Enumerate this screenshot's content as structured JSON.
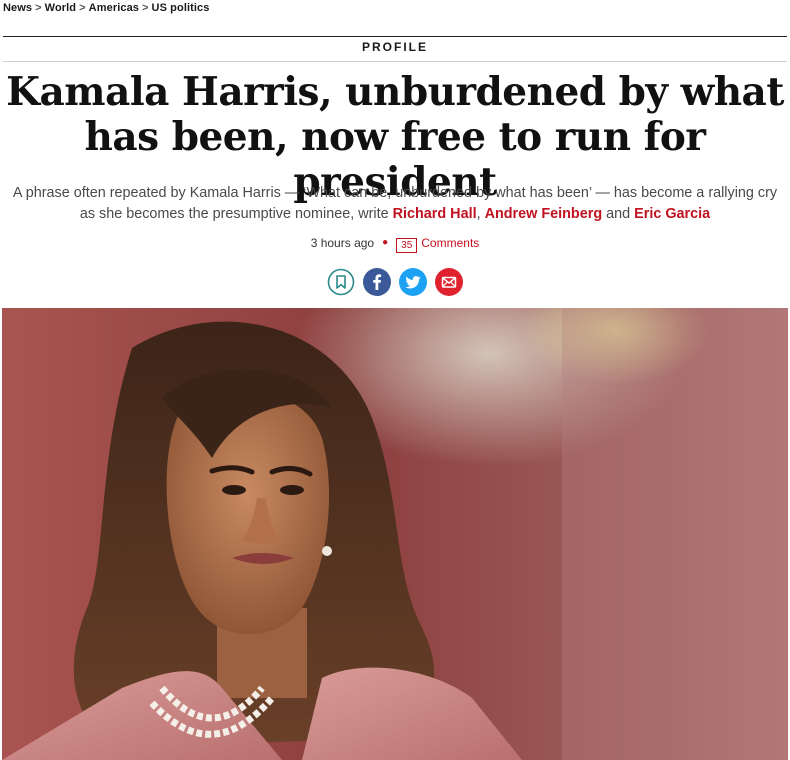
{
  "breadcrumb": {
    "items": [
      {
        "label": "News"
      },
      {
        "label": "World"
      },
      {
        "label": "Americas"
      },
      {
        "label": "US politics"
      }
    ],
    "separator": ">"
  },
  "article": {
    "kicker": "PROFILE",
    "headline_line1": "Kamala Harris, unburdened by what",
    "headline_line2": "has been, now free to run for president",
    "standfirst_text": "A phrase often repeated by Kamala Harris — ‘What can be, unburdened by what has been’ — has become a rallying cry as she becomes the presumptive nominee, write",
    "authors": [
      "Richard Hall",
      "Andrew Feinberg",
      "Eric Garcia"
    ],
    "author_joiner_comma": ",",
    "author_joiner_and": "and",
    "timestamp": "3 hours ago",
    "comment_count": "35",
    "comments_label": "Comments"
  },
  "share": {
    "buttons": [
      {
        "name": "bookmark-icon",
        "color": "#2a8a8a"
      },
      {
        "name": "facebook-icon",
        "color": "#3b5998"
      },
      {
        "name": "twitter-icon",
        "color": "#1da1f2"
      },
      {
        "name": "email-icon",
        "color": "#e0222f"
      }
    ]
  },
  "colors": {
    "accent": "#c1121f",
    "text": "#1a1a1a"
  }
}
